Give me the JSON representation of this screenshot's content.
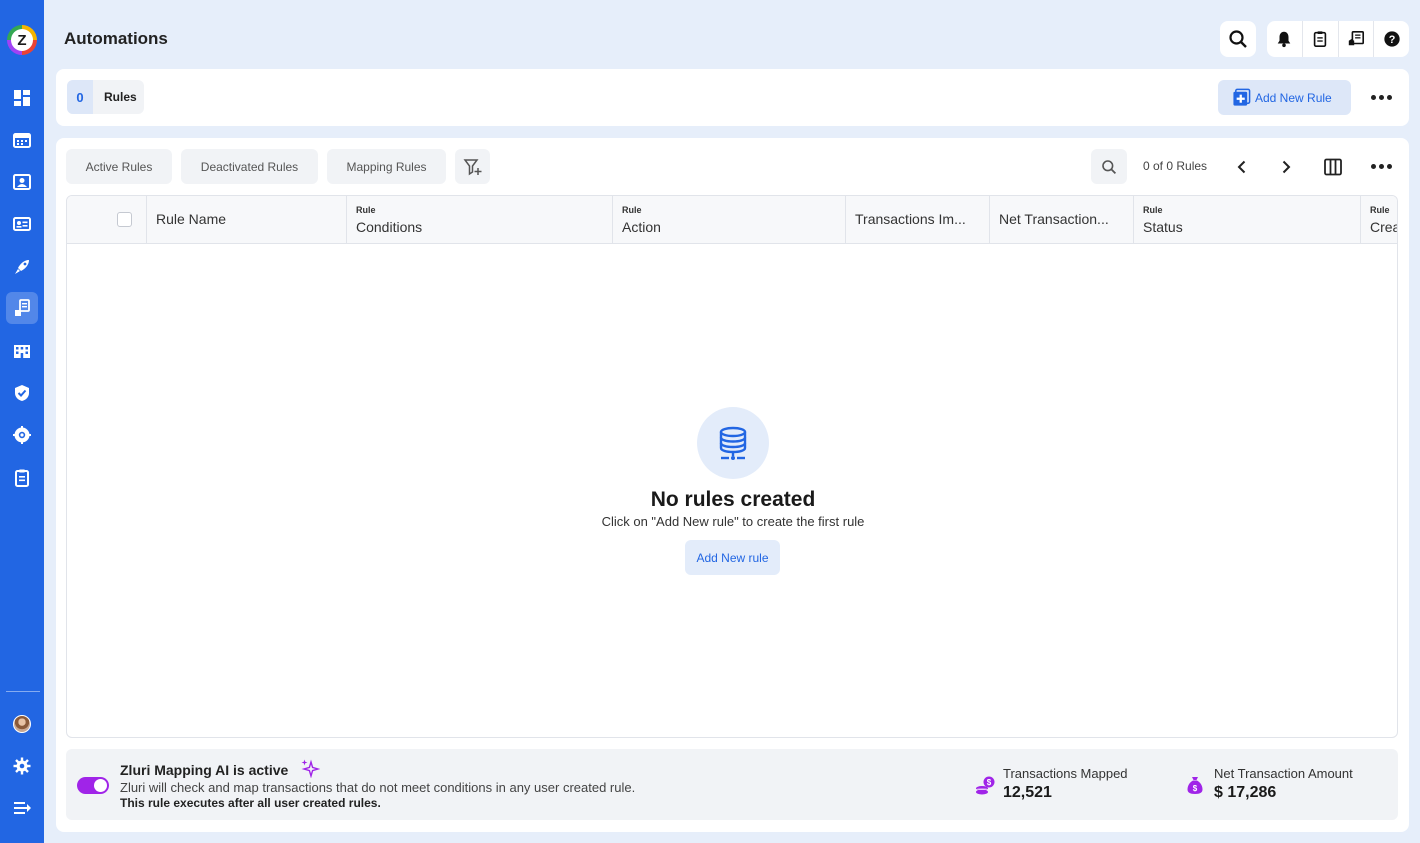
{
  "app": {
    "logo_letter": "Z",
    "page_title": "Automations",
    "accent_color": "#2266e3",
    "sidebar_color": "#2266e3",
    "ai_color": "#a024e8"
  },
  "sidebar": {
    "items": [
      {
        "name": "dashboard-icon"
      },
      {
        "name": "calendar-icon"
      },
      {
        "name": "user-card-icon"
      },
      {
        "name": "id-card-icon"
      },
      {
        "name": "rocket-icon"
      },
      {
        "name": "automation-icon",
        "active": true
      },
      {
        "name": "building-icon"
      },
      {
        "name": "shield-check-icon"
      },
      {
        "name": "integrations-icon"
      },
      {
        "name": "clipboard-icon"
      }
    ],
    "bottom": [
      {
        "name": "avatar"
      },
      {
        "name": "gear-icon"
      },
      {
        "name": "collapse-menu-icon"
      }
    ]
  },
  "header": {
    "icons": [
      "search-icon",
      "bell-icon",
      "clipboard-icon",
      "notes-icon",
      "help-icon"
    ]
  },
  "rules_bar": {
    "count": "0",
    "label": "Rules",
    "add_button": "Add New Rule"
  },
  "filters": {
    "tabs": [
      "Active Rules",
      "Deactivated Rules",
      "Mapping Rules"
    ],
    "pagination": "0 of 0 Rules"
  },
  "table": {
    "columns": [
      {
        "small": "",
        "label": "Rule Name"
      },
      {
        "small": "Rule",
        "label": "Conditions"
      },
      {
        "small": "Rule",
        "label": "Action"
      },
      {
        "small": "",
        "label": "Transactions Im..."
      },
      {
        "small": "",
        "label": "Net Transaction..."
      },
      {
        "small": "Rule",
        "label": "Status"
      },
      {
        "small": "Rule",
        "label": "Crea"
      }
    ],
    "rows": []
  },
  "empty_state": {
    "title": "No rules created",
    "subtitle": "Click on \"Add New rule\" to create the first rule",
    "button": "Add New rule"
  },
  "ai_banner": {
    "enabled": true,
    "title": "Zluri Mapping AI is active",
    "description": "Zluri will check and map transactions that do not meet conditions in any user created rule.",
    "note": "This rule executes after all user created rules.",
    "stats": [
      {
        "label": "Transactions Mapped",
        "value": "12,521",
        "icon": "coins-icon"
      },
      {
        "label": "Net Transaction Amount",
        "value": "$ 17,286",
        "icon": "money-bag-icon"
      }
    ]
  }
}
